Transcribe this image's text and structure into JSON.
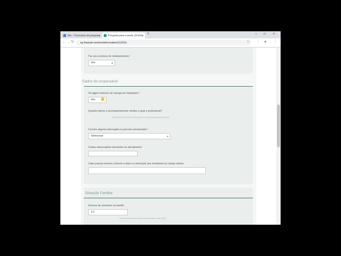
{
  "browser": {
    "tabs": [
      {
        "label": "Wix - Formulário de pesquisa",
        "favicon_color": "#4b7bd6",
        "close": "×"
      },
      {
        "label": "Pesquisa para a saúde (SONO)",
        "favicon_color": "#1c9c8a",
        "close": "×"
      }
    ],
    "new_tab": "+",
    "controls": {
      "minimize": "–",
      "maximize": "□",
      "close": "×"
    },
    "nav": {
      "back": "←",
      "forward": "→",
      "reload": "↻"
    },
    "url": "sp.fhsaúde.mm/forms/formulario/12/2024",
    "tools": {
      "bookmark": "☆",
      "extensions": "⋮",
      "profile": "●",
      "menu": "⋮"
    }
  },
  "form": {
    "prior_section": {
      "question": "Faz uso contínuo de medicamentos?",
      "value": "Sim"
    },
    "clinical_section": {
      "title": "Dados do responsável",
      "q1_label": "Há algum histórico de doença em familiares?",
      "q1_value": "Sim",
      "q2_label": "Quando iniciou o acompanhamento médico e qual o profissional?",
      "q2_hint": "Descreva brevemente os tratamentos e acompanhamentos anteriores",
      "q3_label": "Ocorreu alguma internação no período mencionado?",
      "q3_value": "Selecionar",
      "q4_label": "Outras observações relevantes ao atendimento",
      "q4_value": "",
      "q5_label": "Caso possua exames, informe a data e a descrição dos resultados no campo abaixo",
      "q5_value": ""
    },
    "family_section": {
      "title": "Situação Familiar",
      "q1_label": "Número de membros na família",
      "q1_value": "0.0",
      "q1_hint": "Informe somente os moradores que residem no domicílio"
    }
  }
}
